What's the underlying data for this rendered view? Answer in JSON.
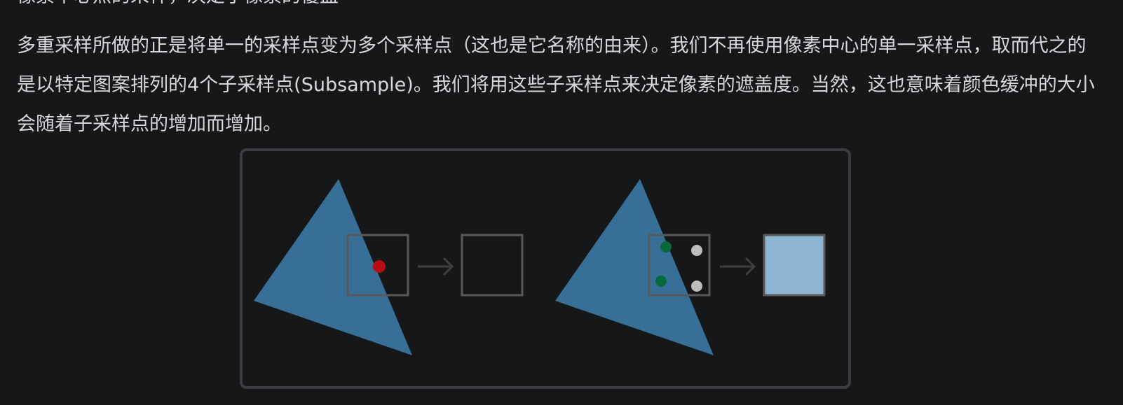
{
  "article": {
    "top_cut_line": "像素中心点的采样，决定了像素的覆盖",
    "paragraph": "多重采样所做的正是将单一的采样点变为多个采样点（这也是它名称的由来）。我们不再使用像素中心的单一采样点，取而代之的是以特定图案排列的4个子采样点(Subsample)。我们将用这些子采样点来决定像素的遮盖度。当然，这也意味着颜色缓冲的大小会随着子采样点的增加而增加。"
  },
  "figure": {
    "colors": {
      "triangle": "#376f96",
      "sample_outline": "#595959",
      "arrow": "#3f3f3f",
      "single_sample": "#b50d12",
      "covered_subsample": "#086a3a",
      "uncovered_subsample": "#bdbdbd",
      "result_fill": "#8db4d1"
    }
  }
}
